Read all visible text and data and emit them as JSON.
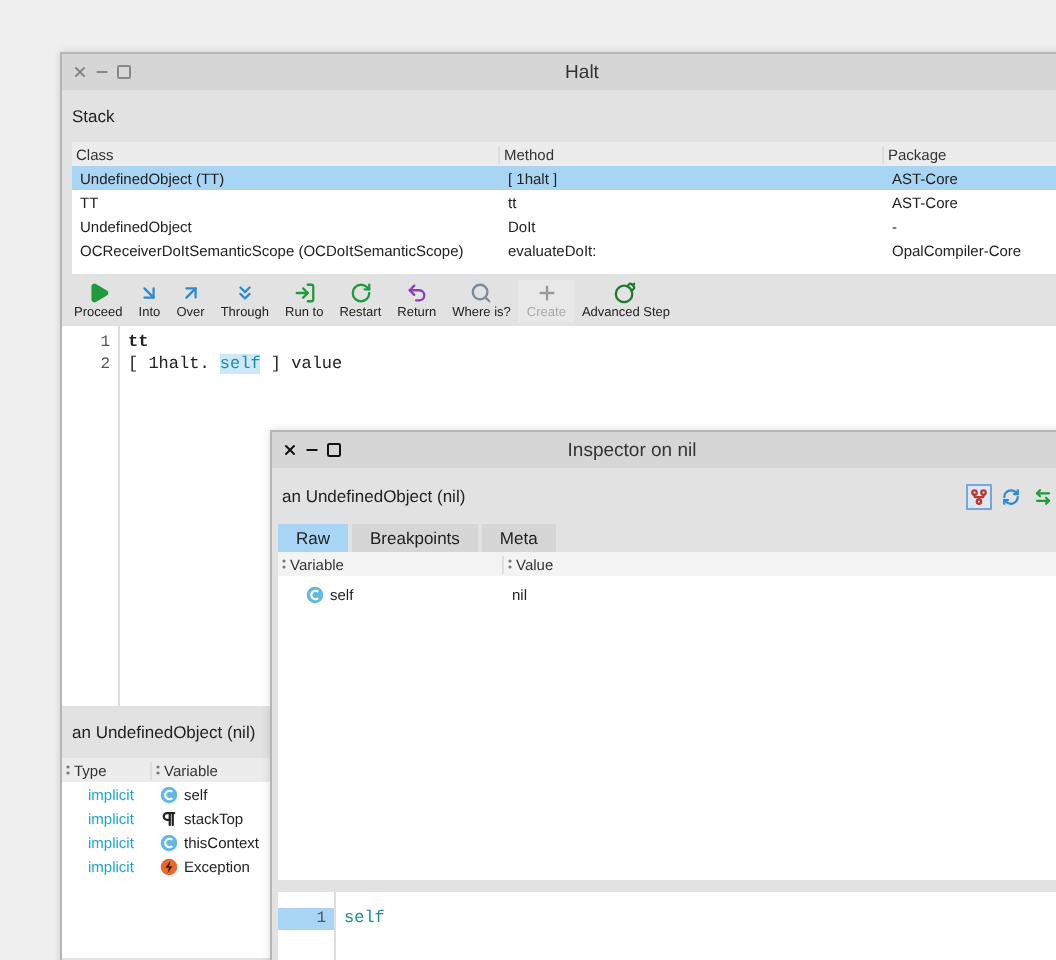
{
  "halt_window": {
    "title": "Halt",
    "active": false,
    "section_label": "Stack",
    "stack_table": {
      "columns": [
        "Class",
        "Method",
        "Package"
      ],
      "rows": [
        {
          "cells": [
            "UndefinedObject (TT)",
            "[ 1halt ]",
            "AST-Core"
          ],
          "selected": true
        },
        {
          "cells": [
            "TT",
            "tt",
            "AST-Core"
          ],
          "selected": false
        },
        {
          "cells": [
            "UndefinedObject",
            "DoIt",
            "-"
          ],
          "selected": false
        },
        {
          "cells": [
            "OCReceiverDoItSemanticScope (OCDoItSemanticScope)",
            "evaluateDoIt:",
            "OpalCompiler-Core"
          ],
          "selected": false
        }
      ]
    },
    "toolbar": [
      {
        "label": "Proceed",
        "kind": "play",
        "disabled": false
      },
      {
        "label": "Into",
        "kind": "into",
        "disabled": false
      },
      {
        "label": "Over",
        "kind": "over",
        "disabled": false
      },
      {
        "label": "Through",
        "kind": "through",
        "disabled": false
      },
      {
        "label": "Run to",
        "kind": "runto",
        "disabled": false
      },
      {
        "label": "Restart",
        "kind": "restart",
        "disabled": false
      },
      {
        "label": "Return",
        "kind": "return",
        "disabled": false
      },
      {
        "label": "Where is?",
        "kind": "search",
        "disabled": false
      },
      {
        "label": "Create",
        "kind": "plus",
        "disabled": true
      },
      {
        "label": "Advanced Step",
        "kind": "bomb",
        "disabled": false
      }
    ],
    "code_lines": [
      {
        "number": "1",
        "segments": [
          {
            "text": "tt",
            "kind": "bold"
          }
        ]
      },
      {
        "number": "2",
        "segments": [
          {
            "text": "[ 1halt. ",
            "kind": "plain"
          },
          {
            "text": "self",
            "kind": "highlight"
          },
          {
            "text": " ] value",
            "kind": "plain"
          }
        ]
      }
    ],
    "context": {
      "title": "an UndefinedObject (nil)",
      "columns": [
        "Type",
        "Variable"
      ],
      "rows": [
        {
          "type": "implicit",
          "variable": "self",
          "kind": "class"
        },
        {
          "type": "implicit",
          "variable": "stackTop",
          "kind": "pilcrow"
        },
        {
          "type": "implicit",
          "variable": "thisContext",
          "kind": "class"
        },
        {
          "type": "implicit",
          "variable": "Exception",
          "kind": "exception"
        }
      ]
    }
  },
  "inspector_window": {
    "title": "Inspector on nil",
    "active": true,
    "subtitle": "an UndefinedObject (nil)",
    "tabs": [
      {
        "label": "Raw",
        "selected": true
      },
      {
        "label": "Breakpoints",
        "selected": false
      },
      {
        "label": "Meta",
        "selected": false
      }
    ],
    "columns": [
      "Variable",
      "Value"
    ],
    "rows": [
      {
        "variable": "self",
        "value": "nil",
        "kind": "class"
      }
    ],
    "code_lines": [
      {
        "number": "1",
        "text": "self",
        "selected": true
      }
    ]
  }
}
